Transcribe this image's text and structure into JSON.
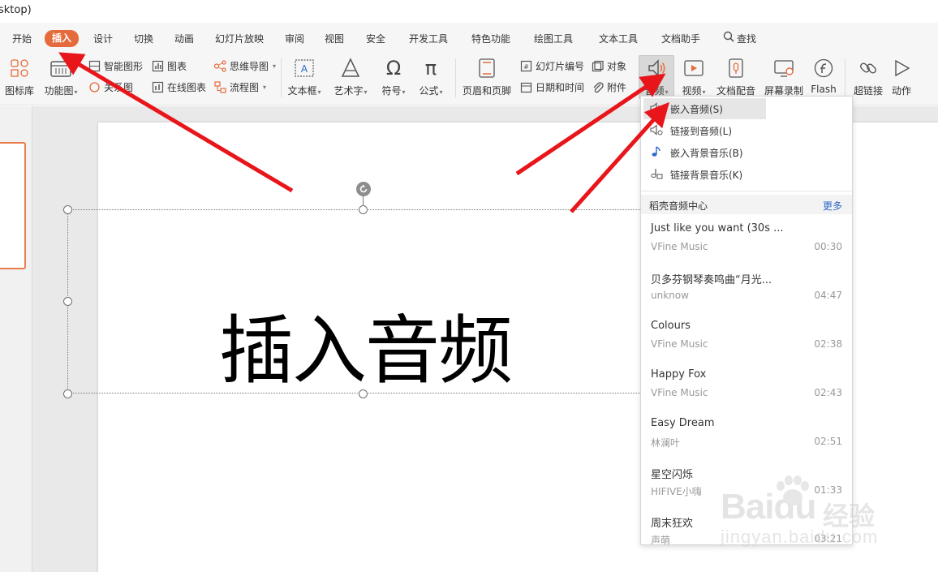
{
  "window": {
    "title_fragment": "sktop)"
  },
  "menu": {
    "tabs": [
      "开始",
      "插入",
      "设计",
      "切换",
      "动画",
      "幻灯片放映",
      "审阅",
      "视图",
      "安全",
      "开发工具",
      "特色功能",
      "绘图工具",
      "文本工具",
      "文档助手"
    ],
    "active_tab": "插入",
    "search_label": "查找"
  },
  "ribbon": {
    "icon_lib": "图标库",
    "func_chart": "功能图",
    "smart_shape": "智能图形",
    "relation": "关系图",
    "chart": "图表",
    "online_chart": "在线图表",
    "mind_map": "思维导图",
    "flowchart": "流程图",
    "textbox": "文本框",
    "wordart": "艺术字",
    "symbol": "符号",
    "formula": "公式",
    "header_footer": "页眉和页脚",
    "slide_number": "幻灯片编号",
    "date_time": "日期和时间",
    "object": "对象",
    "attachment": "附件",
    "audio": "音频",
    "video": "视频",
    "doc_dubbing": "文档配音",
    "screen_record": "屏幕录制",
    "flash": "Flash",
    "hyperlink": "超链接",
    "action": "动作"
  },
  "slide": {
    "title_text": "插入音频"
  },
  "audio_menu": {
    "items": [
      {
        "label": "嵌入音频(S)",
        "icon": "speaker-icon"
      },
      {
        "label": "链接到音频(L)",
        "icon": "speaker-link-icon"
      },
      {
        "label": "嵌入背景音乐(B)",
        "icon": "music-note-icon"
      },
      {
        "label": "链接背景音乐(K)",
        "icon": "music-link-icon"
      }
    ],
    "section_title": "稻壳音频中心",
    "more_label": "更多",
    "tracks": [
      {
        "title": "Just like you want (30s ...",
        "artist": "VFine Music",
        "duration": "00:30"
      },
      {
        "title": "贝多芬钢琴奏鸣曲“月光...",
        "artist": "unknow",
        "duration": "04:47"
      },
      {
        "title": "Colours",
        "artist": "VFine Music",
        "duration": "02:38"
      },
      {
        "title": "Happy Fox",
        "artist": "VFine Music",
        "duration": "02:43"
      },
      {
        "title": "Easy Dream",
        "artist": "林澜叶",
        "duration": "02:51"
      },
      {
        "title": "星空闪烁",
        "artist": "HIFIVE小嗨",
        "duration": "01:33"
      },
      {
        "title": "周末狂欢",
        "artist": "声萌",
        "duration": "03:21"
      }
    ]
  },
  "watermark": {
    "brand": "Baidu",
    "cn": "经验",
    "url": "jingyan.baidu.com"
  },
  "colors": {
    "accent": "#e46b3c",
    "arrow": "#e8161b",
    "link": "#2b67c7"
  }
}
